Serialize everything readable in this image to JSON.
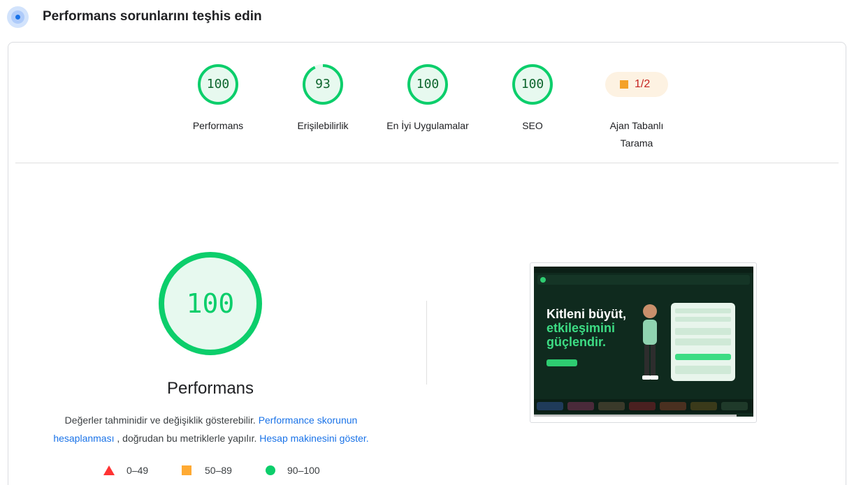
{
  "header": {
    "title": "Performans sorunlarını teşhis edin",
    "icon": "lighthouse-icon"
  },
  "gauges": [
    {
      "label": "Performans",
      "score": "100",
      "fraction": 1.0
    },
    {
      "label": "Erişilebilirlik",
      "score": "93",
      "fraction": 0.93
    },
    {
      "label": "En İyi Uygulamalar",
      "score": "100",
      "fraction": 1.0
    },
    {
      "label": "SEO",
      "score": "100",
      "fraction": 1.0
    }
  ],
  "agent": {
    "value": "1/2",
    "label_line1": "Ajan Tabanlı",
    "label_line2": "Tarama"
  },
  "main": {
    "score": "100",
    "title": "Performans",
    "desc_part1": "Değerler tahminidir ve değişiklik gösterebilir. ",
    "desc_link1": "Performance skorunun hesaplanması",
    "desc_part2": " , doğrudan bu metriklerle yapılır. ",
    "desc_link2": "Hesap makinesini göster."
  },
  "legend": [
    {
      "range": "0–49",
      "icon": "fail-triangle-icon"
    },
    {
      "range": "50–89",
      "icon": "average-square-icon"
    },
    {
      "range": "90–100",
      "icon": "pass-circle-icon"
    }
  ],
  "screenshot": {
    "heading_line1": "Kitleni büyüt,",
    "heading_line2": "etkileşimini",
    "heading_line3": "güçlendir."
  },
  "colors": {
    "pass": "#0cce6b",
    "pass_text": "#0d652d",
    "pass_bg": "#e7f9ef",
    "average": "#ffaa33",
    "fail": "#ff3333",
    "link": "#1a73e8"
  }
}
